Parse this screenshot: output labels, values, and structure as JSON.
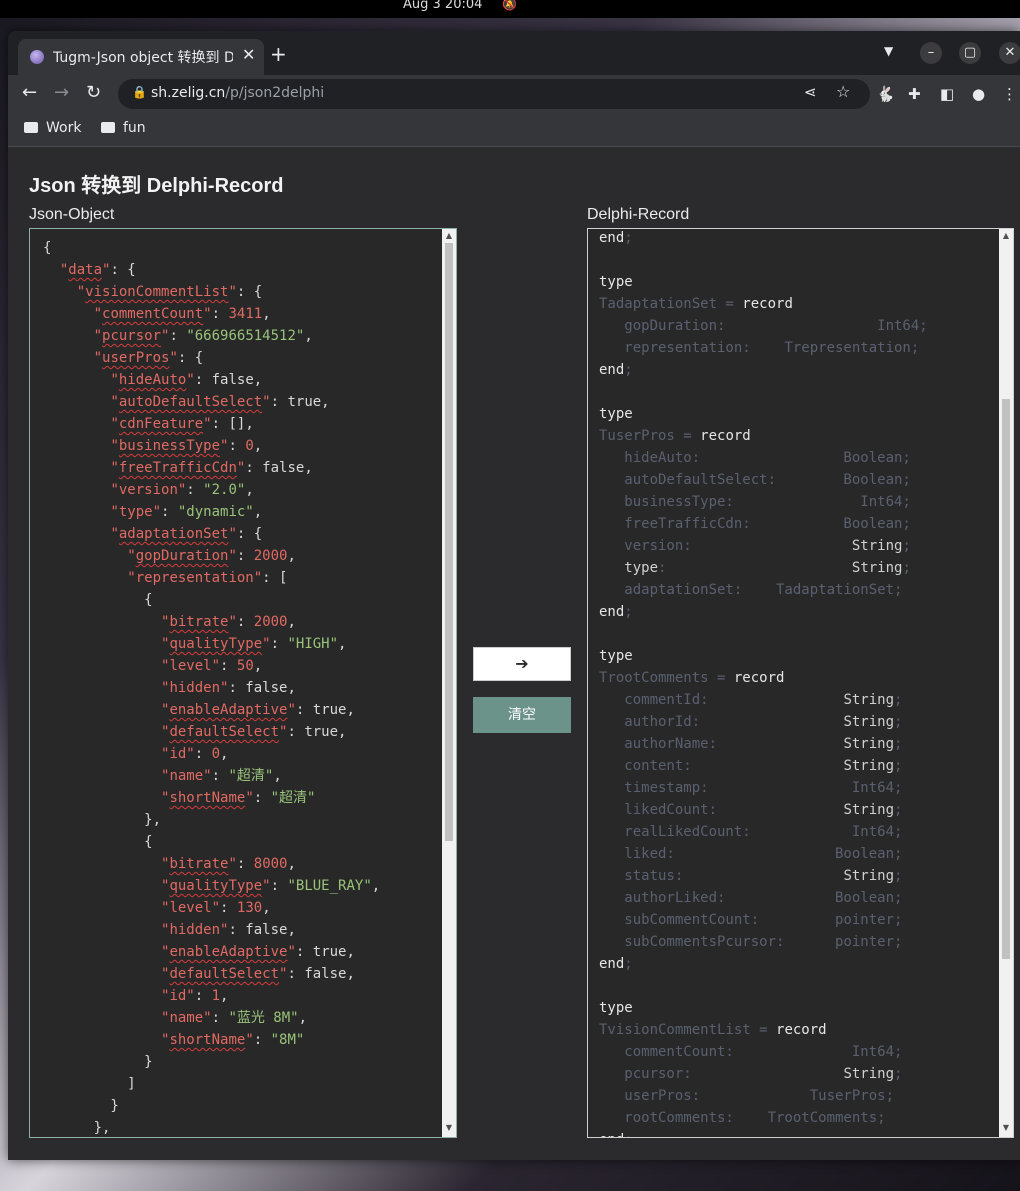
{
  "system": {
    "clock": "Aug 3  20:04"
  },
  "browser": {
    "tab_title": "Tugm-Json object 转换到 D",
    "url_host": "sh.zelig.cn",
    "url_path": "/p/json2delphi",
    "bookmarks": [
      "Work",
      "fun"
    ]
  },
  "page": {
    "title": "Json 转换到 Delphi-Record",
    "left_label": "Json-Object",
    "right_label": "Delphi-Record",
    "convert_button": "➔",
    "clear_button": "清空"
  },
  "json_lines": [
    [
      [
        "p",
        "{"
      ]
    ],
    [
      [
        "p",
        "  "
      ],
      [
        "q",
        "\""
      ],
      [
        "k",
        "data"
      ],
      [
        "q",
        "\""
      ],
      [
        "p",
        ": {"
      ]
    ],
    [
      [
        "p",
        "    "
      ],
      [
        "q",
        "\""
      ],
      [
        "k",
        "visionCommentList"
      ],
      [
        "q",
        "\""
      ],
      [
        "p",
        ": {"
      ]
    ],
    [
      [
        "p",
        "      "
      ],
      [
        "q",
        "\""
      ],
      [
        "k",
        "commentCount"
      ],
      [
        "q",
        "\""
      ],
      [
        "p",
        ": "
      ],
      [
        "n",
        "3411"
      ],
      [
        "p",
        ","
      ]
    ],
    [
      [
        "p",
        "      "
      ],
      [
        "q",
        "\""
      ],
      [
        "k",
        "pcursor"
      ],
      [
        "q",
        "\""
      ],
      [
        "p",
        ": "
      ],
      [
        "s",
        "\"666966514512\""
      ],
      [
        "p",
        ","
      ]
    ],
    [
      [
        "p",
        "      "
      ],
      [
        "q",
        "\""
      ],
      [
        "k",
        "userPros"
      ],
      [
        "q",
        "\""
      ],
      [
        "p",
        ": {"
      ]
    ],
    [
      [
        "p",
        "        "
      ],
      [
        "q",
        "\""
      ],
      [
        "k",
        "hideAuto"
      ],
      [
        "q",
        "\""
      ],
      [
        "p",
        ": false,"
      ]
    ],
    [
      [
        "p",
        "        "
      ],
      [
        "q",
        "\""
      ],
      [
        "k",
        "autoDefaultSelect"
      ],
      [
        "q",
        "\""
      ],
      [
        "p",
        ": true,"
      ]
    ],
    [
      [
        "p",
        "        "
      ],
      [
        "q",
        "\""
      ],
      [
        "k",
        "cdnFeature"
      ],
      [
        "q",
        "\""
      ],
      [
        "p",
        ": [],"
      ]
    ],
    [
      [
        "p",
        "        "
      ],
      [
        "q",
        "\""
      ],
      [
        "k",
        "businessType"
      ],
      [
        "q",
        "\""
      ],
      [
        "p",
        ": "
      ],
      [
        "n",
        "0"
      ],
      [
        "p",
        ","
      ]
    ],
    [
      [
        "p",
        "        "
      ],
      [
        "q",
        "\""
      ],
      [
        "k",
        "freeTrafficCdn"
      ],
      [
        "q",
        "\""
      ],
      [
        "p",
        ": false,"
      ]
    ],
    [
      [
        "p",
        "        "
      ],
      [
        "q",
        "\"version\""
      ],
      [
        "p",
        ": "
      ],
      [
        "s",
        "\"2.0\""
      ],
      [
        "p",
        ","
      ]
    ],
    [
      [
        "p",
        "        "
      ],
      [
        "q",
        "\"type\""
      ],
      [
        "p",
        ": "
      ],
      [
        "s",
        "\"dynamic\""
      ],
      [
        "p",
        ","
      ]
    ],
    [
      [
        "p",
        "        "
      ],
      [
        "q",
        "\""
      ],
      [
        "k",
        "adaptationSet"
      ],
      [
        "q",
        "\""
      ],
      [
        "p",
        ": {"
      ]
    ],
    [
      [
        "p",
        "          "
      ],
      [
        "q",
        "\""
      ],
      [
        "k",
        "gopDuration"
      ],
      [
        "q",
        "\""
      ],
      [
        "p",
        ": "
      ],
      [
        "n",
        "2000"
      ],
      [
        "p",
        ","
      ]
    ],
    [
      [
        "p",
        "          "
      ],
      [
        "q",
        "\"representation\""
      ],
      [
        "p",
        ": ["
      ]
    ],
    [
      [
        "p",
        "            {"
      ]
    ],
    [
      [
        "p",
        "              "
      ],
      [
        "q",
        "\""
      ],
      [
        "k",
        "bitrate"
      ],
      [
        "q",
        "\""
      ],
      [
        "p",
        ": "
      ],
      [
        "n",
        "2000"
      ],
      [
        "p",
        ","
      ]
    ],
    [
      [
        "p",
        "              "
      ],
      [
        "q",
        "\""
      ],
      [
        "k",
        "qualityType"
      ],
      [
        "q",
        "\""
      ],
      [
        "p",
        ": "
      ],
      [
        "s",
        "\"HIGH\""
      ],
      [
        "p",
        ","
      ]
    ],
    [
      [
        "p",
        "              "
      ],
      [
        "q",
        "\"level\""
      ],
      [
        "p",
        ": "
      ],
      [
        "n",
        "50"
      ],
      [
        "p",
        ","
      ]
    ],
    [
      [
        "p",
        "              "
      ],
      [
        "q",
        "\"hidden\""
      ],
      [
        "p",
        ": false,"
      ]
    ],
    [
      [
        "p",
        "              "
      ],
      [
        "q",
        "\""
      ],
      [
        "k",
        "enableAdaptive"
      ],
      [
        "q",
        "\""
      ],
      [
        "p",
        ": true,"
      ]
    ],
    [
      [
        "p",
        "              "
      ],
      [
        "q",
        "\""
      ],
      [
        "k",
        "defaultSelect"
      ],
      [
        "q",
        "\""
      ],
      [
        "p",
        ": true,"
      ]
    ],
    [
      [
        "p",
        "              "
      ],
      [
        "q",
        "\"id\""
      ],
      [
        "p",
        ": "
      ],
      [
        "n",
        "0"
      ],
      [
        "p",
        ","
      ]
    ],
    [
      [
        "p",
        "              "
      ],
      [
        "q",
        "\"name\""
      ],
      [
        "p",
        ": "
      ],
      [
        "s",
        "\"超清\""
      ],
      [
        "p",
        ","
      ]
    ],
    [
      [
        "p",
        "              "
      ],
      [
        "q",
        "\""
      ],
      [
        "k",
        "shortName"
      ],
      [
        "q",
        "\""
      ],
      [
        "p",
        ": "
      ],
      [
        "s",
        "\"超清\""
      ]
    ],
    [
      [
        "p",
        "            },"
      ]
    ],
    [
      [
        "p",
        "            {"
      ]
    ],
    [
      [
        "p",
        "              "
      ],
      [
        "q",
        "\""
      ],
      [
        "k",
        "bitrate"
      ],
      [
        "q",
        "\""
      ],
      [
        "p",
        ": "
      ],
      [
        "n",
        "8000"
      ],
      [
        "p",
        ","
      ]
    ],
    [
      [
        "p",
        "              "
      ],
      [
        "q",
        "\""
      ],
      [
        "k",
        "qualityType"
      ],
      [
        "q",
        "\""
      ],
      [
        "p",
        ": "
      ],
      [
        "s",
        "\"BLUE_RAY\""
      ],
      [
        "p",
        ","
      ]
    ],
    [
      [
        "p",
        "              "
      ],
      [
        "q",
        "\"level\""
      ],
      [
        "p",
        ": "
      ],
      [
        "n",
        "130"
      ],
      [
        "p",
        ","
      ]
    ],
    [
      [
        "p",
        "              "
      ],
      [
        "q",
        "\"hidden\""
      ],
      [
        "p",
        ": false,"
      ]
    ],
    [
      [
        "p",
        "              "
      ],
      [
        "q",
        "\""
      ],
      [
        "k",
        "enableAdaptive"
      ],
      [
        "q",
        "\""
      ],
      [
        "p",
        ": true,"
      ]
    ],
    [
      [
        "p",
        "              "
      ],
      [
        "q",
        "\""
      ],
      [
        "k",
        "defaultSelect"
      ],
      [
        "q",
        "\""
      ],
      [
        "p",
        ": false,"
      ]
    ],
    [
      [
        "p",
        "              "
      ],
      [
        "q",
        "\"id\""
      ],
      [
        "p",
        ": "
      ],
      [
        "n",
        "1"
      ],
      [
        "p",
        ","
      ]
    ],
    [
      [
        "p",
        "              "
      ],
      [
        "q",
        "\"name\""
      ],
      [
        "p",
        ": "
      ],
      [
        "s",
        "\"蓝光 8M\""
      ],
      [
        "p",
        ","
      ]
    ],
    [
      [
        "p",
        "              "
      ],
      [
        "q",
        "\""
      ],
      [
        "k",
        "shortName"
      ],
      [
        "q",
        "\""
      ],
      [
        "p",
        ": "
      ],
      [
        "s",
        "\"8M\""
      ]
    ],
    [
      [
        "p",
        "            }"
      ]
    ],
    [
      [
        "p",
        "          ]"
      ]
    ],
    [
      [
        "p",
        "        }"
      ]
    ],
    [
      [
        "p",
        "      },"
      ]
    ]
  ],
  "delphi_lines": [
    [
      [
        "kw",
        "end"
      ],
      [
        "dim",
        ";"
      ]
    ],
    [
      [
        "p",
        ""
      ]
    ],
    [
      [
        "kw",
        "type"
      ]
    ],
    [
      [
        "dim",
        "TadaptationSet = "
      ],
      [
        "kw",
        "record"
      ]
    ],
    [
      [
        "dim",
        "   gopDuration:                  Int64;"
      ]
    ],
    [
      [
        "dim",
        "   representation:    Trepresentation;"
      ]
    ],
    [
      [
        "kw",
        "end"
      ],
      [
        "dim",
        ";"
      ]
    ],
    [
      [
        "p",
        ""
      ]
    ],
    [
      [
        "kw",
        "type"
      ]
    ],
    [
      [
        "dim",
        "TuserPros = "
      ],
      [
        "kw",
        "record"
      ]
    ],
    [
      [
        "dim",
        "   hideAuto:                 Boolean;"
      ]
    ],
    [
      [
        "dim",
        "   autoDefaultSelect:        Boolean;"
      ]
    ],
    [
      [
        "dim",
        "   businessType:               Int64;"
      ]
    ],
    [
      [
        "dim",
        "   freeTrafficCdn:           Boolean;"
      ]
    ],
    [
      [
        "dim",
        "   version:                   "
      ],
      [
        "ty",
        "String"
      ],
      [
        "dim",
        ";"
      ]
    ],
    [
      [
        "dim",
        "   "
      ],
      [
        "ty",
        "type"
      ],
      [
        "dim",
        ":                      "
      ],
      [
        "ty",
        "String"
      ],
      [
        "dim",
        ";"
      ]
    ],
    [
      [
        "dim",
        "   adaptationSet:    TadaptationSet;"
      ]
    ],
    [
      [
        "kw",
        "end"
      ],
      [
        "dim",
        ";"
      ]
    ],
    [
      [
        "p",
        ""
      ]
    ],
    [
      [
        "kw",
        "type"
      ]
    ],
    [
      [
        "dim",
        "TrootComments = "
      ],
      [
        "kw",
        "record"
      ]
    ],
    [
      [
        "dim",
        "   commentId:                "
      ],
      [
        "ty",
        "String"
      ],
      [
        "dim",
        ";"
      ]
    ],
    [
      [
        "dim",
        "   authorId:                 "
      ],
      [
        "ty",
        "String"
      ],
      [
        "dim",
        ";"
      ]
    ],
    [
      [
        "dim",
        "   authorName:               "
      ],
      [
        "ty",
        "String"
      ],
      [
        "dim",
        ";"
      ]
    ],
    [
      [
        "dim",
        "   content:                  "
      ],
      [
        "ty",
        "String"
      ],
      [
        "dim",
        ";"
      ]
    ],
    [
      [
        "dim",
        "   timestamp:                 Int64;"
      ]
    ],
    [
      [
        "dim",
        "   likedCount:               "
      ],
      [
        "ty",
        "String"
      ],
      [
        "dim",
        ";"
      ]
    ],
    [
      [
        "dim",
        "   realLikedCount:            Int64;"
      ]
    ],
    [
      [
        "dim",
        "   liked:                   Boolean;"
      ]
    ],
    [
      [
        "dim",
        "   status:                   "
      ],
      [
        "ty",
        "String"
      ],
      [
        "dim",
        ";"
      ]
    ],
    [
      [
        "dim",
        "   authorLiked:             Boolean;"
      ]
    ],
    [
      [
        "dim",
        "   subCommentCount:         pointer;"
      ]
    ],
    [
      [
        "dim",
        "   subCommentsPcursor:      pointer;"
      ]
    ],
    [
      [
        "kw",
        "end"
      ],
      [
        "dim",
        ";"
      ]
    ],
    [
      [
        "p",
        ""
      ]
    ],
    [
      [
        "kw",
        "type"
      ]
    ],
    [
      [
        "dim",
        "TvisionCommentList = "
      ],
      [
        "kw",
        "record"
      ]
    ],
    [
      [
        "dim",
        "   commentCount:              Int64;"
      ]
    ],
    [
      [
        "dim",
        "   pcursor:                  "
      ],
      [
        "ty",
        "String"
      ],
      [
        "dim",
        ";"
      ]
    ],
    [
      [
        "dim",
        "   userPros:             TuserPros;"
      ]
    ],
    [
      [
        "dim",
        "   rootComments:    TrootComments;"
      ]
    ],
    [
      [
        "kw",
        "end"
      ],
      [
        "dim",
        ";"
      ]
    ]
  ]
}
